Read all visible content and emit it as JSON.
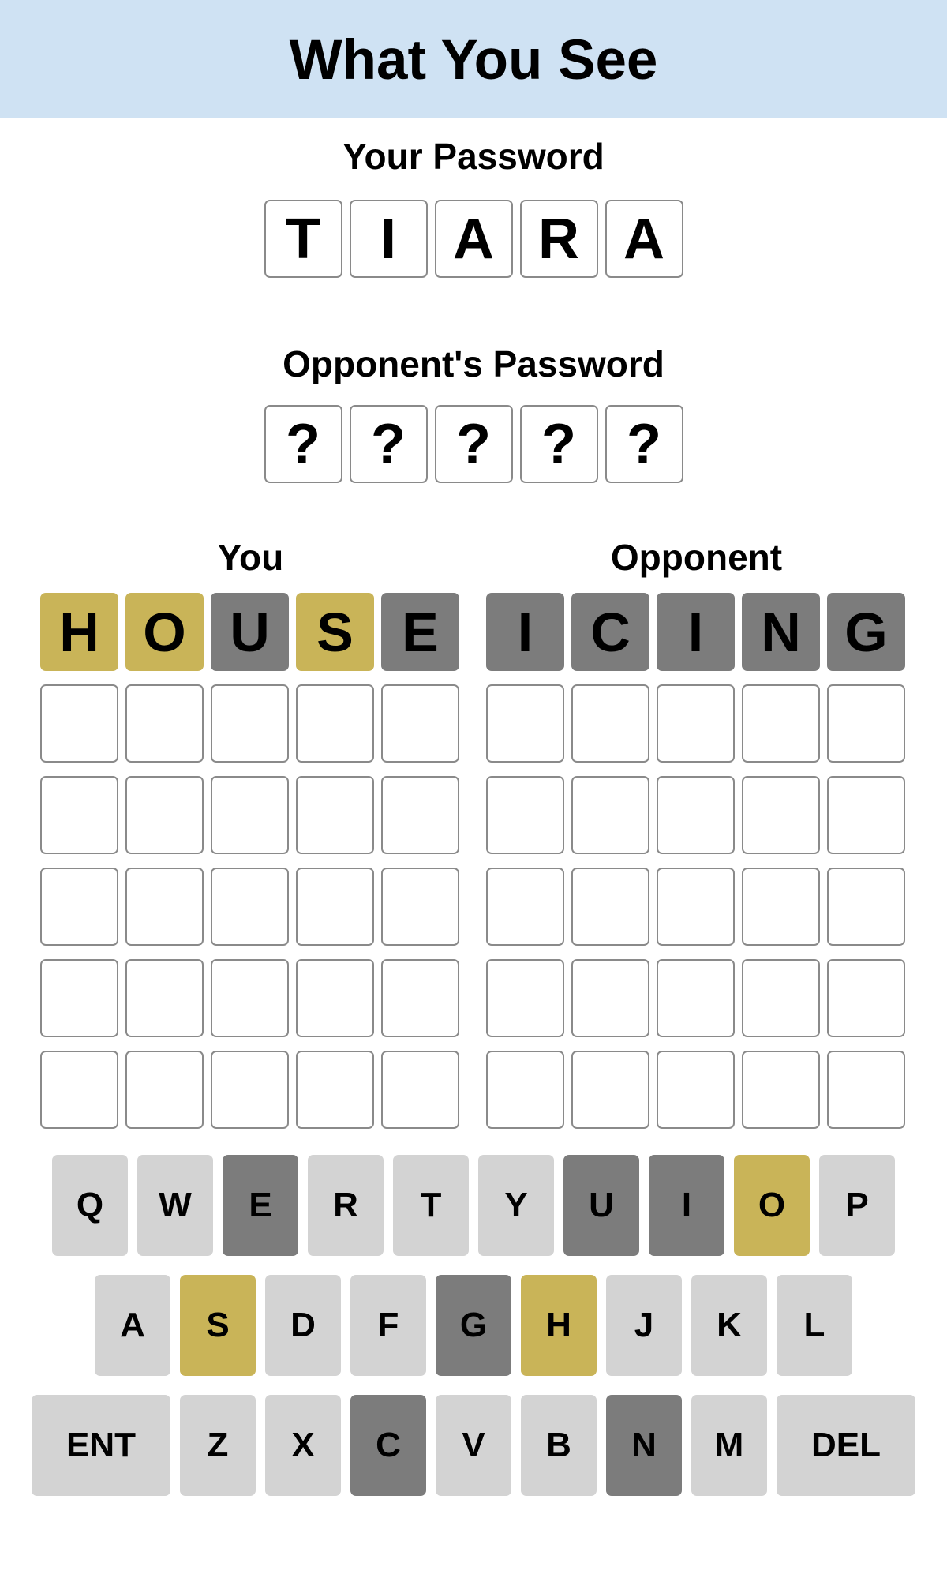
{
  "header": {
    "title": "What You See"
  },
  "your_password": {
    "label": "Your Password",
    "letters": [
      "T",
      "I",
      "A",
      "R",
      "A"
    ]
  },
  "opponent_password": {
    "label": "Opponent's Password",
    "letters": [
      "?",
      "?",
      "?",
      "?",
      "?"
    ]
  },
  "boards": {
    "you": {
      "title": "You",
      "rows": [
        [
          {
            "l": "H",
            "s": "gold"
          },
          {
            "l": "O",
            "s": "gold"
          },
          {
            "l": "U",
            "s": "gray"
          },
          {
            "l": "S",
            "s": "gold"
          },
          {
            "l": "E",
            "s": "gray"
          }
        ],
        [
          {
            "l": "",
            "s": "empty"
          },
          {
            "l": "",
            "s": "empty"
          },
          {
            "l": "",
            "s": "empty"
          },
          {
            "l": "",
            "s": "empty"
          },
          {
            "l": "",
            "s": "empty"
          }
        ],
        [
          {
            "l": "",
            "s": "empty"
          },
          {
            "l": "",
            "s": "empty"
          },
          {
            "l": "",
            "s": "empty"
          },
          {
            "l": "",
            "s": "empty"
          },
          {
            "l": "",
            "s": "empty"
          }
        ],
        [
          {
            "l": "",
            "s": "empty"
          },
          {
            "l": "",
            "s": "empty"
          },
          {
            "l": "",
            "s": "empty"
          },
          {
            "l": "",
            "s": "empty"
          },
          {
            "l": "",
            "s": "empty"
          }
        ],
        [
          {
            "l": "",
            "s": "empty"
          },
          {
            "l": "",
            "s": "empty"
          },
          {
            "l": "",
            "s": "empty"
          },
          {
            "l": "",
            "s": "empty"
          },
          {
            "l": "",
            "s": "empty"
          }
        ],
        [
          {
            "l": "",
            "s": "empty"
          },
          {
            "l": "",
            "s": "empty"
          },
          {
            "l": "",
            "s": "empty"
          },
          {
            "l": "",
            "s": "empty"
          },
          {
            "l": "",
            "s": "empty"
          }
        ]
      ]
    },
    "opponent": {
      "title": "Opponent",
      "rows": [
        [
          {
            "l": "I",
            "s": "gray"
          },
          {
            "l": "C",
            "s": "gray"
          },
          {
            "l": "I",
            "s": "gray"
          },
          {
            "l": "N",
            "s": "gray"
          },
          {
            "l": "G",
            "s": "gray"
          }
        ],
        [
          {
            "l": "",
            "s": "empty"
          },
          {
            "l": "",
            "s": "empty"
          },
          {
            "l": "",
            "s": "empty"
          },
          {
            "l": "",
            "s": "empty"
          },
          {
            "l": "",
            "s": "empty"
          }
        ],
        [
          {
            "l": "",
            "s": "empty"
          },
          {
            "l": "",
            "s": "empty"
          },
          {
            "l": "",
            "s": "empty"
          },
          {
            "l": "",
            "s": "empty"
          },
          {
            "l": "",
            "s": "empty"
          }
        ],
        [
          {
            "l": "",
            "s": "empty"
          },
          {
            "l": "",
            "s": "empty"
          },
          {
            "l": "",
            "s": "empty"
          },
          {
            "l": "",
            "s": "empty"
          },
          {
            "l": "",
            "s": "empty"
          }
        ],
        [
          {
            "l": "",
            "s": "empty"
          },
          {
            "l": "",
            "s": "empty"
          },
          {
            "l": "",
            "s": "empty"
          },
          {
            "l": "",
            "s": "empty"
          },
          {
            "l": "",
            "s": "empty"
          }
        ],
        [
          {
            "l": "",
            "s": "empty"
          },
          {
            "l": "",
            "s": "empty"
          },
          {
            "l": "",
            "s": "empty"
          },
          {
            "l": "",
            "s": "empty"
          },
          {
            "l": "",
            "s": "empty"
          }
        ]
      ]
    }
  },
  "keyboard": {
    "rows": [
      [
        {
          "k": "Q",
          "s": "default"
        },
        {
          "k": "W",
          "s": "default"
        },
        {
          "k": "E",
          "s": "gray"
        },
        {
          "k": "R",
          "s": "default"
        },
        {
          "k": "T",
          "s": "default"
        },
        {
          "k": "Y",
          "s": "default"
        },
        {
          "k": "U",
          "s": "gray"
        },
        {
          "k": "I",
          "s": "gray"
        },
        {
          "k": "O",
          "s": "gold"
        },
        {
          "k": "P",
          "s": "default"
        }
      ],
      [
        {
          "k": "A",
          "s": "default"
        },
        {
          "k": "S",
          "s": "gold"
        },
        {
          "k": "D",
          "s": "default"
        },
        {
          "k": "F",
          "s": "default"
        },
        {
          "k": "G",
          "s": "gray"
        },
        {
          "k": "H",
          "s": "gold"
        },
        {
          "k": "J",
          "s": "default"
        },
        {
          "k": "K",
          "s": "default"
        },
        {
          "k": "L",
          "s": "default"
        }
      ],
      [
        {
          "k": "ENT",
          "s": "default",
          "wide": true
        },
        {
          "k": "Z",
          "s": "default"
        },
        {
          "k": "X",
          "s": "default"
        },
        {
          "k": "C",
          "s": "gray"
        },
        {
          "k": "V",
          "s": "default"
        },
        {
          "k": "B",
          "s": "default"
        },
        {
          "k": "N",
          "s": "gray"
        },
        {
          "k": "M",
          "s": "default"
        },
        {
          "k": "DEL",
          "s": "default",
          "wide": true
        }
      ]
    ]
  },
  "colors": {
    "gold": "#c9b458",
    "gray": "#7c7c7c",
    "key_default": "#d3d3d3",
    "header_bg": "#cfe2f3"
  }
}
